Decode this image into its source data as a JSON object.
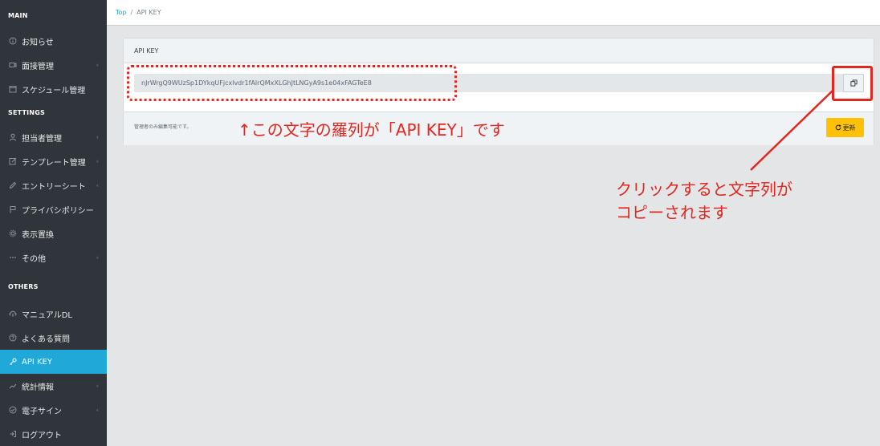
{
  "sidebar": {
    "sections": {
      "main": "MAIN",
      "settings": "SETTINGS",
      "others": "OTHERS"
    },
    "items": {
      "news": "お知らせ",
      "interview": "面接管理",
      "schedule": "スケジュール管理",
      "staff": "担当者管理",
      "template": "テンプレート管理",
      "entry_sheet": "エントリーシート",
      "privacy": "プライバシポリシー",
      "display": "表示置換",
      "other": "その他",
      "manual": "マニュアルDL",
      "faq": "よくある質問",
      "api_key": "API KEY",
      "stats": "統計情報",
      "esign": "電子サイン",
      "logout": "ログアウト"
    }
  },
  "breadcrumb": {
    "top": "Top",
    "separator": "/",
    "current": "API KEY"
  },
  "card": {
    "title": "API KEY",
    "api_key_value": "nJrWrgQ9WUzSp1DYkqUFjcxlvdr1fAlrQMxXLGhJtLNGyA9s1e04xFAGTeE8",
    "footer_note": "管理者のみ編集可能です。",
    "update_label": "更新"
  },
  "annotations": {
    "key_explanation": "↑この文字の羅列が「API KEY」です",
    "copy_explanation_line1": "クリックすると文字列が",
    "copy_explanation_line2": "コピーされます"
  },
  "colors": {
    "sidebar_bg": "#2f353a",
    "active_bg": "#20a8d8",
    "annotation_red": "#e3261e",
    "update_button": "#ffc107"
  }
}
